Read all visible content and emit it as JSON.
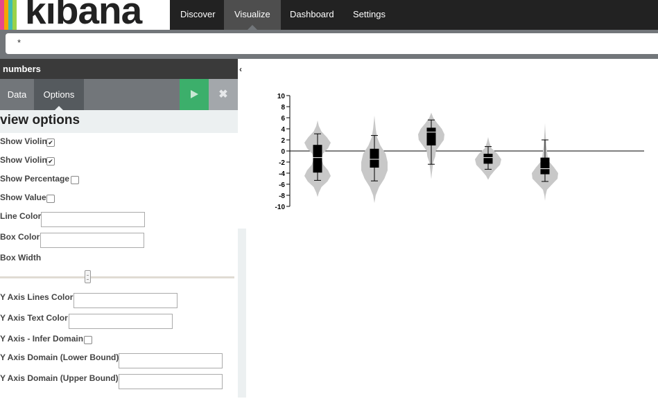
{
  "app": {
    "logo_text": "kibana",
    "logo_colors": [
      "#e8488b",
      "#f5a700",
      "#3ebeb0",
      "#9ad249"
    ]
  },
  "nav": {
    "tabs": [
      {
        "label": "Discover"
      },
      {
        "label": "Visualize"
      },
      {
        "label": "Dashboard"
      },
      {
        "label": "Settings"
      }
    ],
    "active": "Visualize"
  },
  "search": {
    "query": "*"
  },
  "sidebar": {
    "title": "numbers",
    "tabs": [
      {
        "label": "Data"
      },
      {
        "label": "Options"
      }
    ],
    "active_tab": "Options",
    "apply_icon": "play-icon",
    "discard_icon": "close-icon",
    "section_title": "view options",
    "options": {
      "show_violin_1": {
        "label": "Show Violin",
        "checked": true
      },
      "show_violin_2": {
        "label": "Show Violin",
        "checked": true
      },
      "show_percentage": {
        "label": "Show Percentage",
        "checked": false
      },
      "show_value": {
        "label": "Show Value",
        "checked": false
      },
      "line_color": {
        "label": "Line Color",
        "value": ""
      },
      "box_color": {
        "label": "Box Color",
        "value": ""
      },
      "box_width": {
        "label": "Box Width",
        "level": 0.37
      },
      "y_axis_lines_color": {
        "label": "Y Axis Lines Color",
        "value": ""
      },
      "y_axis_text_color": {
        "label": "Y Axis Text Color",
        "value": ""
      },
      "y_axis_infer_domain": {
        "label": "Y Axis - Infer Domain",
        "checked": false
      },
      "y_axis_domain_lower": {
        "label": "Y Axis Domain (Lower Bound)",
        "value": ""
      },
      "y_axis_domain_upper": {
        "label": "Y Axis Domain (Upper Bound)",
        "value": ""
      }
    },
    "collapse_icon": "chevron-left-icon"
  },
  "chart_data": {
    "type": "violin-box",
    "y_ticks": [
      10,
      8,
      6,
      4,
      2,
      0,
      -2,
      -4,
      -6,
      -8,
      -10
    ],
    "ylim": [
      -10,
      10
    ],
    "zero_line": true,
    "colors": {
      "violin": "#c8c8c8",
      "box": "#000000",
      "line": "#000000"
    },
    "series": [
      {
        "whisker_low": -5.3,
        "q1": -3.9,
        "median": -1.2,
        "q3": 1.1,
        "whisker_high": 3.1,
        "min": -8.3,
        "max": 5.5,
        "density": [
          [
            -8.3,
            0
          ],
          [
            -7.5,
            0.1
          ],
          [
            -6.5,
            0.3
          ],
          [
            -5.5,
            0.75
          ],
          [
            -4.5,
            1.0
          ],
          [
            -3.5,
            0.8
          ],
          [
            -2.5,
            0.45
          ],
          [
            -1.5,
            0.3
          ],
          [
            -0.5,
            0.4
          ],
          [
            0.5,
            0.8
          ],
          [
            1.5,
            1.0
          ],
          [
            2.5,
            0.7
          ],
          [
            3.5,
            0.3
          ],
          [
            4.5,
            0.1
          ],
          [
            5.5,
            0
          ]
        ]
      },
      {
        "whisker_low": -5.4,
        "q1": -3.0,
        "median": -1.5,
        "q3": 0.4,
        "whisker_high": 2.8,
        "min": -9.4,
        "max": 6.4,
        "density": [
          [
            -9.4,
            0
          ],
          [
            -8,
            0.1
          ],
          [
            -6.5,
            0.35
          ],
          [
            -5,
            0.75
          ],
          [
            -3.5,
            1.0
          ],
          [
            -2,
            1.0
          ],
          [
            -0.5,
            0.85
          ],
          [
            1,
            0.45
          ],
          [
            2.5,
            0.2
          ],
          [
            4,
            0.1
          ],
          [
            5.2,
            0.05
          ],
          [
            6.4,
            0
          ]
        ]
      },
      {
        "whisker_low": -2.4,
        "q1": 1.0,
        "median": 3.4,
        "q3": 4.2,
        "whisker_high": 5.6,
        "min": -5.1,
        "max": 6.9,
        "density": [
          [
            -5.1,
            0
          ],
          [
            -4,
            0.05
          ],
          [
            -3,
            0.1
          ],
          [
            -2,
            0.15
          ],
          [
            -1,
            0.3
          ],
          [
            0,
            0.35
          ],
          [
            1,
            0.65
          ],
          [
            2,
            0.95
          ],
          [
            3,
            1.0
          ],
          [
            4,
            0.8
          ],
          [
            5,
            0.45
          ],
          [
            6,
            0.15
          ],
          [
            6.9,
            0
          ]
        ]
      },
      {
        "whisker_low": -3.3,
        "q1": -2.3,
        "median": -1.2,
        "q3": -0.5,
        "whisker_high": 0.8,
        "min": -5.2,
        "max": 2.5,
        "density": [
          [
            -5.2,
            0
          ],
          [
            -4.5,
            0.15
          ],
          [
            -3.5,
            0.5
          ],
          [
            -2.5,
            0.9
          ],
          [
            -1.5,
            1.0
          ],
          [
            -0.5,
            0.7
          ],
          [
            0.5,
            0.25
          ],
          [
            1.5,
            0.1
          ],
          [
            2.5,
            0
          ]
        ]
      },
      {
        "whisker_low": -5.5,
        "q1": -4.2,
        "median": -3.2,
        "q3": -1.2,
        "whisker_high": 2.0,
        "min": -9.0,
        "max": 5.0,
        "density": [
          [
            -9,
            0
          ],
          [
            -8,
            0.05
          ],
          [
            -7,
            0.15
          ],
          [
            -6,
            0.55
          ],
          [
            -5,
            0.95
          ],
          [
            -4,
            1.0
          ],
          [
            -3,
            0.7
          ],
          [
            -2,
            0.35
          ],
          [
            -1,
            0.2
          ],
          [
            0,
            0.15
          ],
          [
            1,
            0.1
          ],
          [
            2,
            0.08
          ],
          [
            3,
            0.05
          ],
          [
            4,
            0.02
          ],
          [
            5,
            0
          ]
        ]
      }
    ]
  }
}
